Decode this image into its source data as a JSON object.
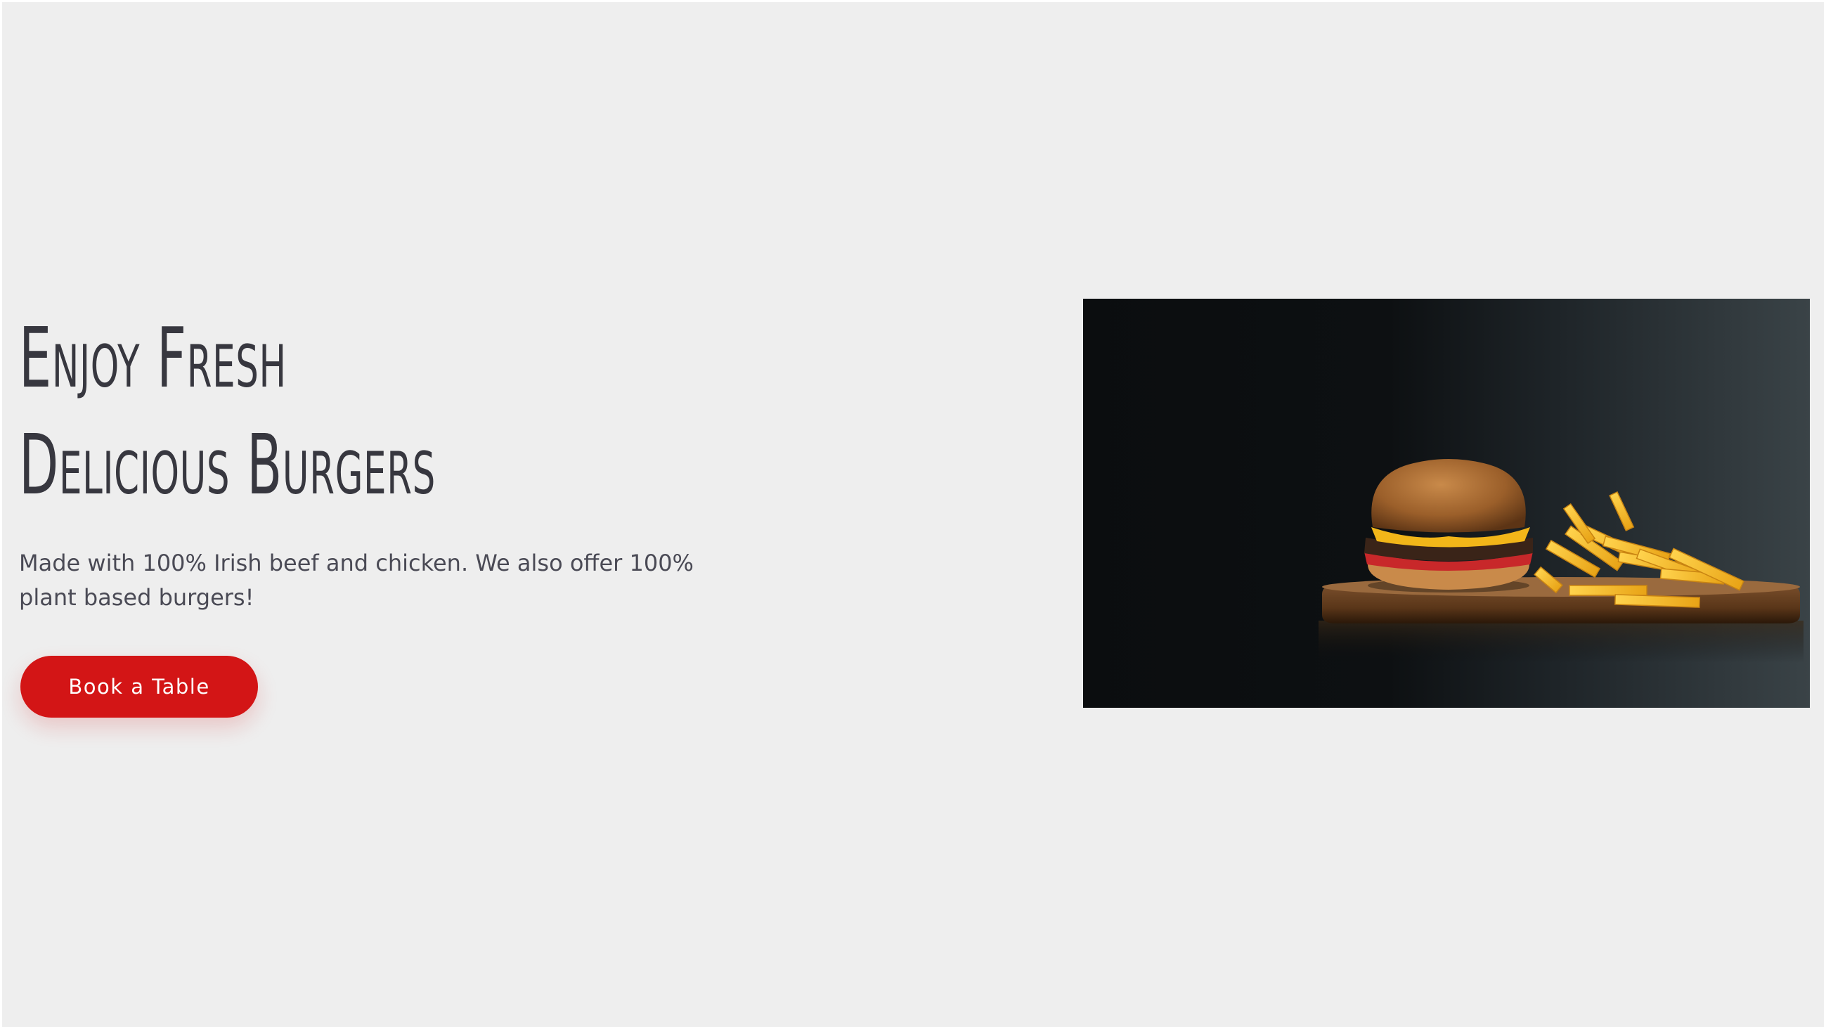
{
  "hero": {
    "title_line1": "Enjoy Fresh",
    "title_line2": "Delicious Burgers",
    "subtitle": "Made with 100% Irish beef and chicken. We also offer 100% plant based burgers!",
    "button_label": "Book a Table"
  },
  "colors": {
    "background": "#eeeeee",
    "title": "#37373f",
    "body_text": "#4a4a55",
    "button": "#d31516",
    "button_text": "#ffffff"
  }
}
